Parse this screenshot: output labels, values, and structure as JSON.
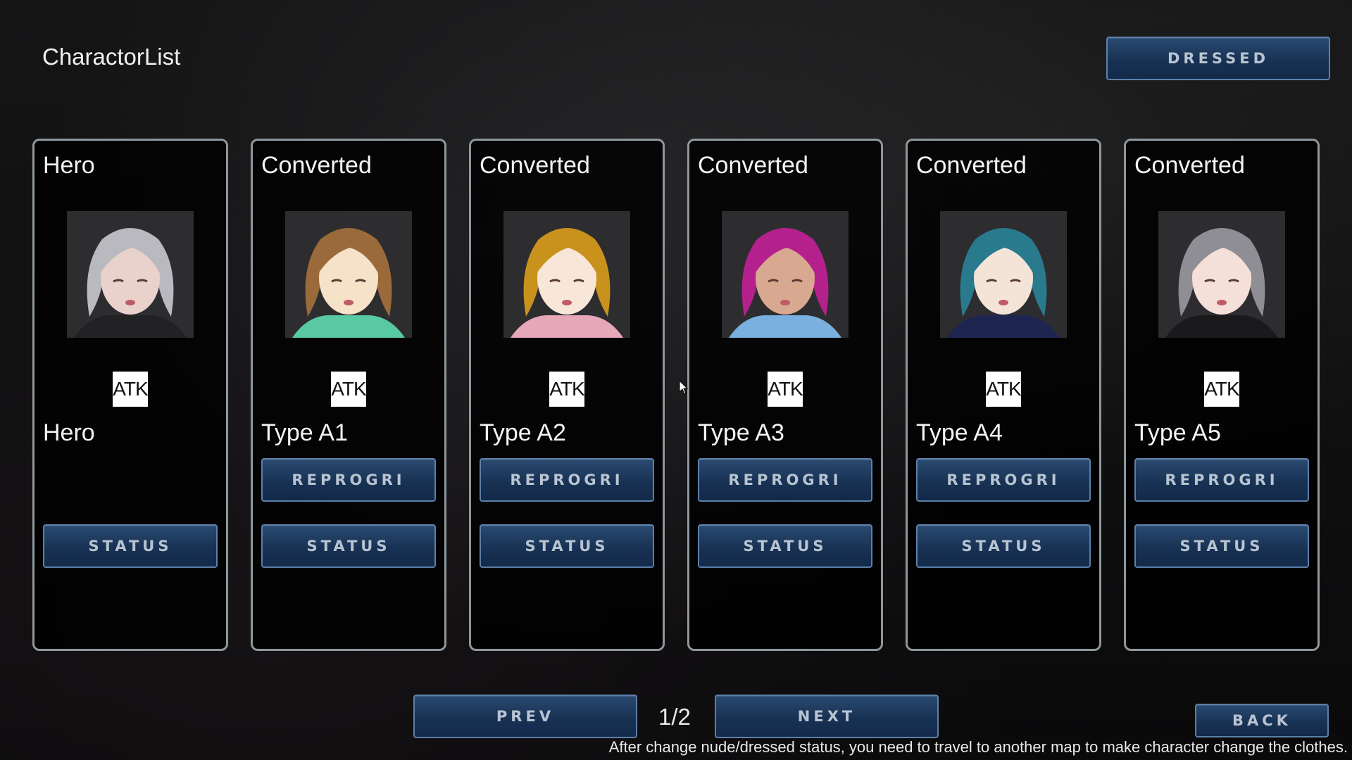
{
  "header": {
    "title": "CharactorList",
    "dressed_label": "DRESSED"
  },
  "cards": [
    {
      "category": "Hero",
      "portrait": "hero-portrait",
      "hair_color": "#b9b9bf",
      "skin_color": "#e9d2cc",
      "outfit_color": "#222224",
      "atk_label": "ATK",
      "name": "Hero",
      "reprogram_label": null,
      "status_label": "STATUS"
    },
    {
      "category": "Converted",
      "portrait": "type-a1-portrait",
      "hair_color": "#9a6a3a",
      "skin_color": "#f6e2c8",
      "outfit_color": "#59c9a4",
      "atk_label": "ATK",
      "name": "Type A1",
      "reprogram_label": "REPROGRI",
      "status_label": "STATUS"
    },
    {
      "category": "Converted",
      "portrait": "type-a2-portrait",
      "hair_color": "#c8921c",
      "skin_color": "#f8e6d8",
      "outfit_color": "#e6a8b8",
      "atk_label": "ATK",
      "name": "Type A2",
      "reprogram_label": "REPROGRI",
      "status_label": "STATUS"
    },
    {
      "category": "Converted",
      "portrait": "type-a3-portrait",
      "hair_color": "#b4208c",
      "skin_color": "#d8a890",
      "outfit_color": "#7ab0e0",
      "atk_label": "ATK",
      "name": "Type A3",
      "reprogram_label": "REPROGRI",
      "status_label": "STATUS"
    },
    {
      "category": "Converted",
      "portrait": "type-a4-portrait",
      "hair_color": "#2a7a8e",
      "skin_color": "#f4e4d8",
      "outfit_color": "#1e2550",
      "atk_label": "ATK",
      "name": "Type A4",
      "reprogram_label": "REPROGRI",
      "status_label": "STATUS"
    },
    {
      "category": "Converted",
      "portrait": "type-a5-portrait",
      "hair_color": "#8e8e94",
      "skin_color": "#f4e0d8",
      "outfit_color": "#1a1a1c",
      "atk_label": "ATK",
      "name": "Type A5",
      "reprogram_label": "REPROGRI",
      "status_label": "STATUS"
    }
  ],
  "pagination": {
    "prev_label": "PREV",
    "next_label": "NEXT",
    "page": "1/2"
  },
  "back_label": "BACK",
  "footer_note": "After change nude/dressed status, you need to travel to another map to make character change the clothes."
}
